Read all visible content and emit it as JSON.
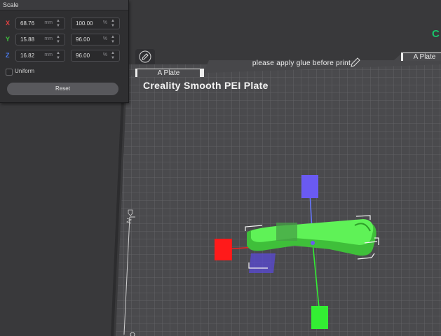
{
  "scale_panel": {
    "title": "Scale",
    "rows": [
      {
        "axis": "X",
        "color": "#e04040",
        "value": "68.76",
        "unit": "mm",
        "percent": "100.00",
        "percent_unit": "%"
      },
      {
        "axis": "Y",
        "color": "#3fc43f",
        "value": "15.88",
        "unit": "mm",
        "percent": "96.00",
        "percent_unit": "%"
      },
      {
        "axis": "Z",
        "color": "#4a7bf0",
        "value": "16.82",
        "unit": "mm",
        "percent": "96.00",
        "percent_unit": "%"
      }
    ],
    "uniform_label": "Uniform",
    "uniform_checked": false,
    "reset_label": "Reset"
  },
  "bed": {
    "tab_left": "A Plate",
    "tab_right": "A Plate",
    "note": "please apply glue before print",
    "title": "Creality Smooth PEI Plate"
  },
  "colors": {
    "accent": "#19c46a",
    "model": "#4ee047",
    "handle_x": "#ff1a1a",
    "handle_y": "#33ee33",
    "handle_z": "#6a5af2"
  },
  "icons": {
    "edit": "pencil-icon",
    "note_edit": "pencil-icon",
    "ruler": "ruler-icon"
  }
}
